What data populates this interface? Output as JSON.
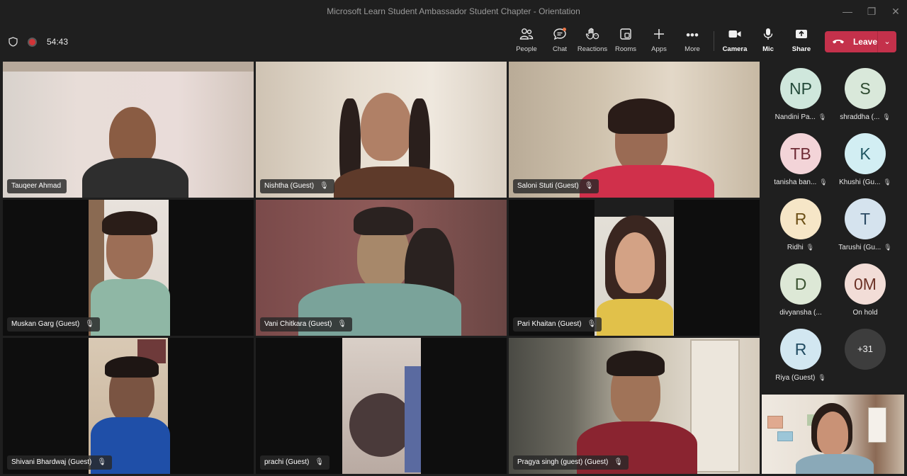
{
  "window": {
    "title": "Microsoft Learn Student Ambassador Student Chapter - Orientation"
  },
  "meeting": {
    "timer": "54:43"
  },
  "toolbar": {
    "people": "People",
    "chat": "Chat",
    "reactions": "Reactions",
    "rooms": "Rooms",
    "apps": "Apps",
    "more": "More",
    "camera": "Camera",
    "mic": "Mic",
    "share": "Share",
    "leave": "Leave"
  },
  "videos": [
    {
      "name": "Tauqeer Ahmad",
      "muted": false
    },
    {
      "name": "Nishtha (Guest)",
      "muted": true
    },
    {
      "name": "Saloni Stuti (Guest)",
      "muted": true
    },
    {
      "name": "Muskan Garg (Guest)",
      "muted": true
    },
    {
      "name": "Vani Chitkara (Guest)",
      "muted": true
    },
    {
      "name": "Pari Khaitan (Guest)",
      "muted": true
    },
    {
      "name": "Shivani Bhardwaj (Guest)",
      "muted": true
    },
    {
      "name": "prachi (Guest)",
      "muted": true
    },
    {
      "name": "Pragya singh (guest) (Guest)",
      "muted": true
    }
  ],
  "participants": [
    {
      "initials": "NP",
      "label": "Nandini Pa...",
      "muted": true,
      "bg": "#cfe7dc",
      "fg": "#244a3a"
    },
    {
      "initials": "S",
      "label": "shraddha (...",
      "muted": true,
      "bg": "#d9e8da",
      "fg": "#2e4a30"
    },
    {
      "initials": "TB",
      "label": "tanisha ban...",
      "muted": true,
      "bg": "#f3d4d8",
      "fg": "#6e2a35"
    },
    {
      "initials": "K",
      "label": "Khushi (Gu...",
      "muted": true,
      "bg": "#d2eef3",
      "fg": "#1f5561"
    },
    {
      "initials": "R",
      "label": "Ridhi",
      "muted": true,
      "bg": "#f6e6c7",
      "fg": "#6b4f16"
    },
    {
      "initials": "T",
      "label": "Tarushi (Gu...",
      "muted": true,
      "bg": "#d5e3ee",
      "fg": "#2b4a63"
    },
    {
      "initials": "D",
      "label": "divyansha (...",
      "muted": false,
      "bg": "#dde8d6",
      "fg": "#3a5230"
    },
    {
      "initials": "0M",
      "label": "On hold",
      "muted": false,
      "bg": "#f2ddd7",
      "fg": "#6b3226"
    },
    {
      "initials": "R",
      "label": "Riya (Guest)",
      "muted": true,
      "bg": "#d2e7f1",
      "fg": "#224c62"
    },
    {
      "initials": "+31",
      "label": "",
      "muted": false,
      "bg": "#3d3d3d",
      "fg": "#f0f0f0"
    }
  ],
  "icons": {
    "mic_off": "mic-off-icon",
    "shield": "shield-icon",
    "record": "record-icon"
  },
  "colors": {
    "leave": "#c4314b",
    "record": "#d13438",
    "notify": "#e97548"
  }
}
